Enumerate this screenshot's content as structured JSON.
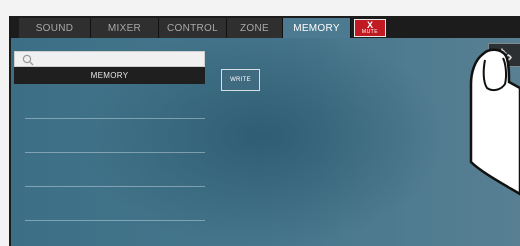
{
  "tabs": [
    {
      "label": "SOUND",
      "active": false
    },
    {
      "label": "MIXER",
      "active": false
    },
    {
      "label": "CONTROL",
      "active": false
    },
    {
      "label": "ZONE",
      "active": false
    },
    {
      "label": "MEMORY",
      "active": true
    }
  ],
  "mute": {
    "symbol": "X",
    "label": "MUTE"
  },
  "memory_panel": {
    "search_placeholder": "",
    "header": "MEMORY",
    "rows": [
      "",
      "",
      "",
      ""
    ]
  },
  "write_button": {
    "label": "WRITE"
  },
  "icons": {
    "search": "search-icon",
    "settings": "gear-icon",
    "finger": "pointing-finger-icon"
  },
  "colors": {
    "background": "#47778d",
    "tab_bar": "#1c1c1c",
    "active_tab": "#4c7a90",
    "mute": "#c21a22"
  }
}
